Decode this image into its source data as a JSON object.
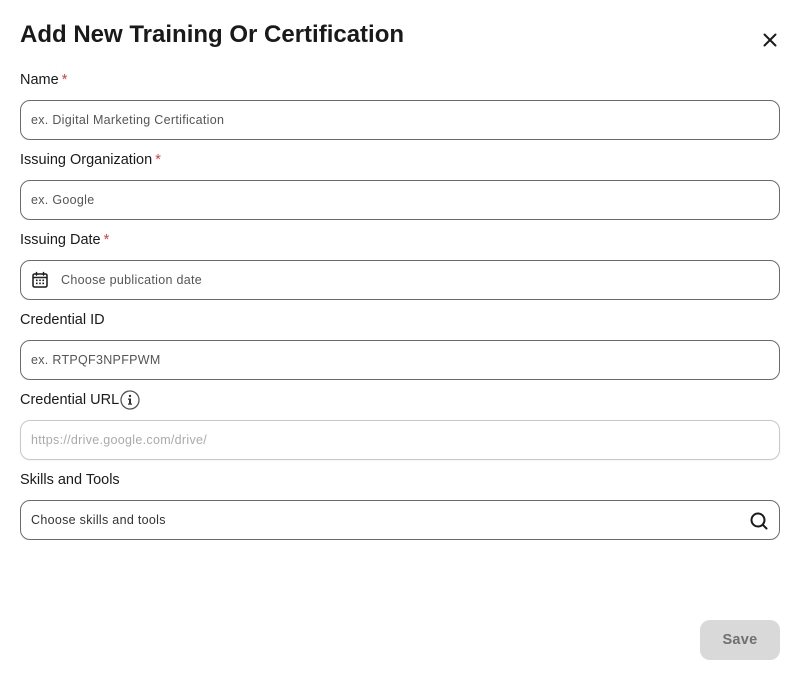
{
  "dialog": {
    "title": "Add New Training Or Certification",
    "close_icon": "close-icon"
  },
  "fields": {
    "name": {
      "label": "Name",
      "required_mark": "*",
      "placeholder": "ex. Digital Marketing Certification",
      "value": ""
    },
    "issuing_org": {
      "label": "Issuing Organization",
      "required_mark": "*",
      "placeholder": "ex. Google",
      "value": ""
    },
    "issuing_date": {
      "label": "Issuing Date",
      "required_mark": "*",
      "placeholder": "Choose publication date",
      "value": "",
      "icon": "calendar-icon"
    },
    "credential_id": {
      "label": "Credential ID",
      "placeholder": "ex. RTPQF3NPFPWM",
      "value": ""
    },
    "credential_url": {
      "label": "Credential URL",
      "placeholder": "https://drive.google.com/drive/",
      "value": "",
      "icon": "info-icon"
    },
    "skills": {
      "label": "Skills and Tools",
      "placeholder": "Choose skills and tools",
      "value": "",
      "icon": "search-icon"
    }
  },
  "actions": {
    "save_label": "Save"
  },
  "colors": {
    "required": "#e53935",
    "border": "#6b6b6b",
    "save_bg": "#d9d9d9",
    "save_text": "#707070"
  }
}
